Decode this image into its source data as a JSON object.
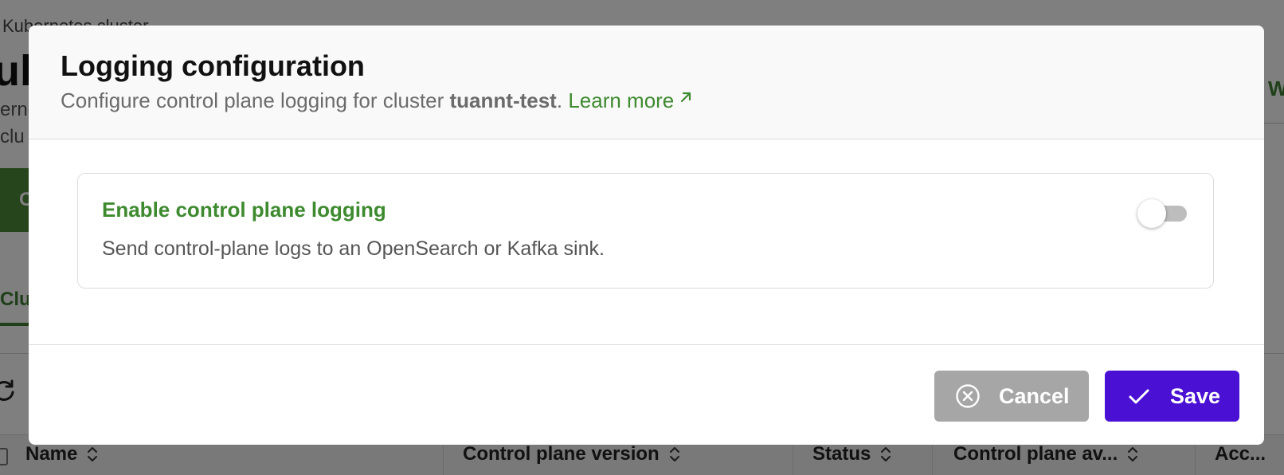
{
  "background": {
    "breadcrumb": "Kubernetes cluster",
    "page_title": "ub",
    "desc_line_1": "erne",
    "desc_line_2": "clu",
    "create_button_label": "C",
    "tab_label": "Clu",
    "right_link": "W",
    "table_headers": [
      {
        "label": "Name"
      },
      {
        "label": "Control plane version"
      },
      {
        "label": "Status"
      },
      {
        "label": "Control plane av..."
      },
      {
        "label": "Acc..."
      }
    ]
  },
  "modal": {
    "title": "Logging configuration",
    "subtitle_prefix": "Configure control plane logging for cluster ",
    "cluster_name": "tuannt-test",
    "subtitle_period": ".",
    "learn_more_label": "Learn more",
    "setting": {
      "title": "Enable control plane logging",
      "description": "Send control-plane logs to an OpenSearch or Kafka sink.",
      "enabled": false
    },
    "footer": {
      "cancel_label": "Cancel",
      "save_label": "Save"
    }
  },
  "colors": {
    "accent_green": "#3e8a2f",
    "primary_button": "#4a10d3",
    "cancel_button": "#a6a6a6",
    "overlay": "rgba(0,0,0,0.5)"
  },
  "icons": {
    "external_link": "arrow-up-right-icon",
    "cancel": "x-circle-icon",
    "save": "check-icon",
    "sort": "sort-icon",
    "refresh": "refresh-icon"
  }
}
